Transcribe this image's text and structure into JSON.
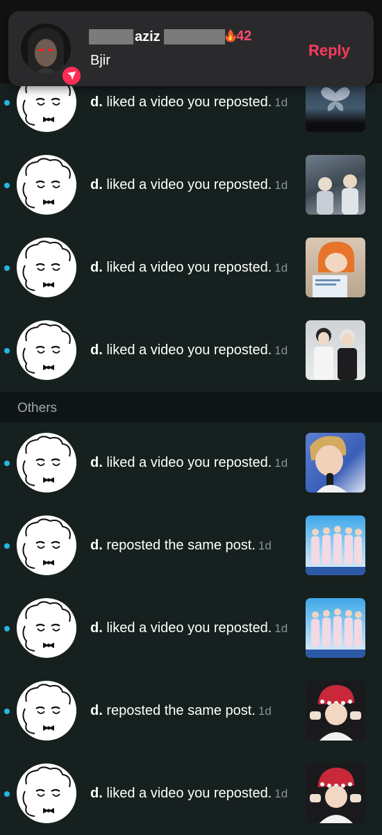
{
  "notification": {
    "username_visible": "aziz",
    "streak_count": "42",
    "message": "Bjir",
    "reply_label": "Reply"
  },
  "section_header": "Others",
  "rows": [
    {
      "name": "d.",
      "action": "liked a video you reposted.",
      "time": "1d",
      "thumb": "dark-butterfly"
    },
    {
      "name": "d.",
      "action": "liked a video you reposted.",
      "time": "1d",
      "thumb": "stage-people"
    },
    {
      "name": "d.",
      "action": "liked a video you reposted.",
      "time": "1d",
      "thumb": "orange-hood"
    },
    {
      "name": "d.",
      "action": "liked a video you reposted.",
      "time": "1d",
      "thumb": "two-people"
    },
    {
      "name": "d.",
      "action": "liked a video you reposted.",
      "time": "1d",
      "thumb": "singer-blue"
    },
    {
      "name": "d.",
      "action": "reposted the same post.",
      "time": "1d",
      "thumb": "group-blue"
    },
    {
      "name": "d.",
      "action": "liked a video you reposted.",
      "time": "1d",
      "thumb": "group-blue"
    },
    {
      "name": "d.",
      "action": "reposted the same post.",
      "time": "1d",
      "thumb": "red-hat"
    },
    {
      "name": "d.",
      "action": "liked a video you reposted.",
      "time": "1d",
      "thumb": "red-hat"
    }
  ],
  "colors": {
    "background": "#16201f",
    "unread_dot": "#25b6e6",
    "accent_red": "#fe2c55"
  }
}
